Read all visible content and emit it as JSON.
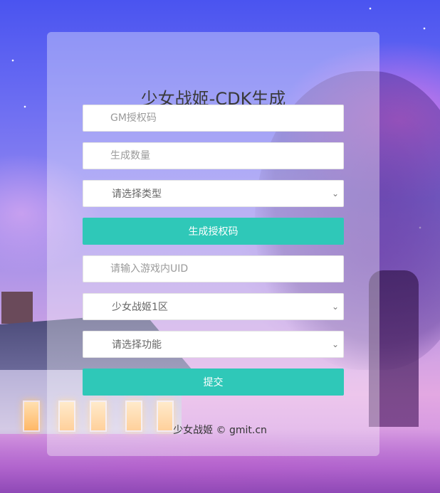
{
  "page": {
    "title": "少女战姬-CDK生成",
    "footer": "少女战姬 © gmit.cn"
  },
  "form": {
    "gm_code_placeholder": "GM授权码",
    "quantity_placeholder": "生成数量",
    "type_select_value": "请选择类型",
    "generate_button": "生成授权码",
    "uid_placeholder": "请输入游戏内UID",
    "server_select_value": "少女战姬1区",
    "function_select_value": "请选择功能",
    "submit_button": "提交"
  },
  "colors": {
    "accent": "#2fc8b8"
  }
}
